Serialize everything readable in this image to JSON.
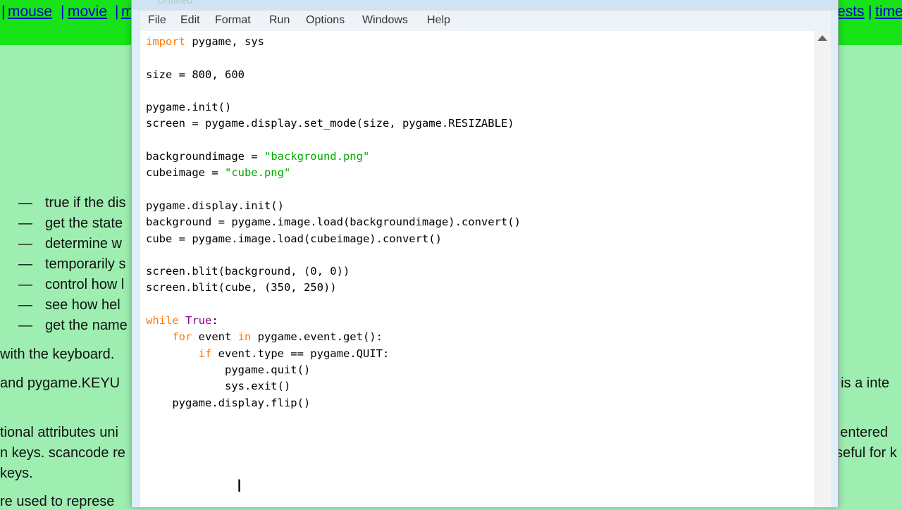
{
  "background_page": {
    "nav_links": [
      "mouse",
      "movie",
      "m",
      "ests",
      "time"
    ],
    "nav_separators": [
      "|",
      "|",
      "|",
      "|",
      "|"
    ],
    "bullet_dash": "—",
    "bullets": [
      "true if the dis",
      "get the state",
      "determine w",
      "temporarily s",
      "control how l",
      "see how hel",
      "get the name"
    ],
    "left_text": [
      "with the keyboard.",
      "and pygame.KEYU",
      "tional attributes uni",
      "n keys. scancode re",
      "keys.",
      "re used to represe"
    ],
    "right_text": [
      "t is a inte",
      "r entered",
      "seful for k"
    ]
  },
  "window": {
    "title": "*Untitled*",
    "menu": [
      "File",
      "Edit",
      "Format",
      "Run",
      "Options",
      "Windows",
      "Help"
    ]
  },
  "code": {
    "l1_import": "import",
    "l1_rest": " pygame, sys",
    "l2": "size = 800, 600",
    "l3": "pygame.init()",
    "l4": "screen = pygame.display.set_mode(size, pygame.RESIZABLE)",
    "l5_a": "backgroundimage = ",
    "l5_str": "\"background.png\"",
    "l6_a": "cubeimage = ",
    "l6_str": "\"cube.png\"",
    "l7": "pygame.display.init()",
    "l8": "background = pygame.image.load(backgroundimage).convert()",
    "l9": "cube = pygame.image.load(cubeimage).convert()",
    "l10": "screen.blit(background, (0, 0))",
    "l11": "screen.blit(cube, (350, 250))",
    "l12_while": "while",
    "l12_true": "True",
    "l12_colon": ":",
    "l13_for": "for",
    "l13_a": " event ",
    "l13_in": "in",
    "l13_b": " pygame.event.get():",
    "l14_if": "if",
    "l14_rest": " event.type == pygame.QUIT:",
    "l15": "pygame.quit()",
    "l16": "sys.exit()",
    "l17": "pygame.display.flip()"
  },
  "cursor_glyph": "I"
}
